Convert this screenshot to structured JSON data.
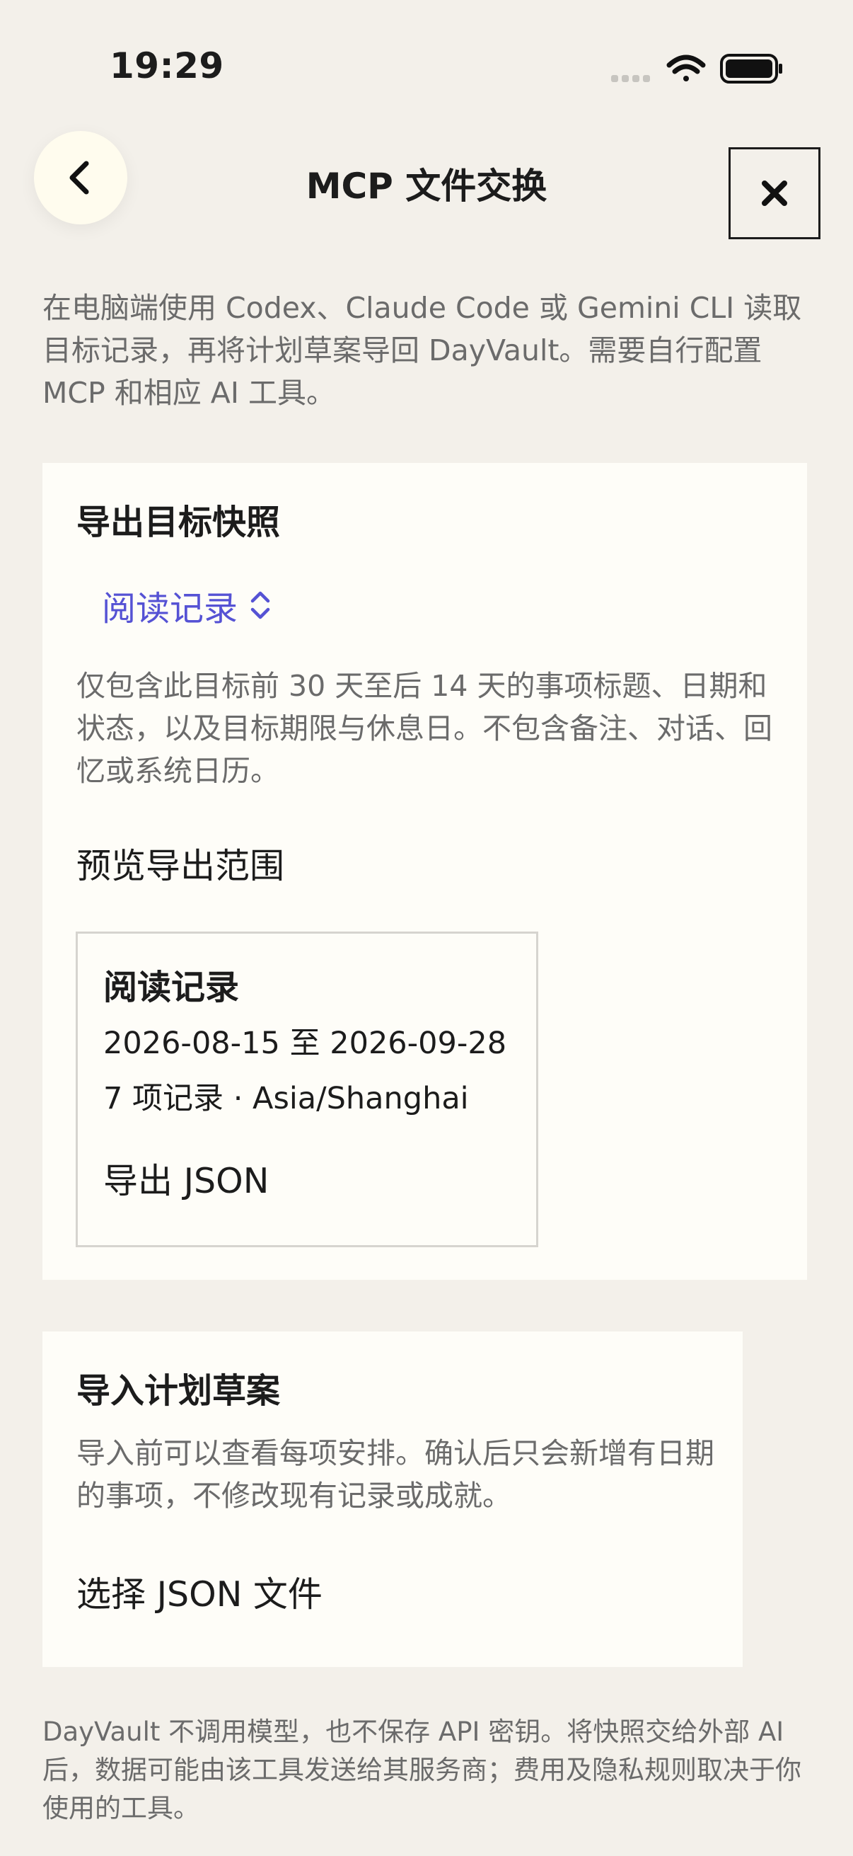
{
  "status_bar": {
    "time": "19:29",
    "icons": [
      "signal-icon",
      "wifi-icon",
      "battery-icon"
    ]
  },
  "nav": {
    "back_icon": "chevron-left-icon",
    "title": "MCP 文件交换",
    "close_icon": "close-icon"
  },
  "intro": "在电脑端使用 Codex、Claude Code 或 Gemini CLI 读取目标记录，再将计划草案导回 DayVault。需要自行配置 MCP 和相应 AI 工具。",
  "export": {
    "title": "导出目标快照",
    "goal_picker": {
      "selected": "阅读记录",
      "icon": "chevron-up-down-icon"
    },
    "description": "仅包含此目标前 30 天至后 14 天的事项标题、日期和状态，以及目标期限与休息日。不包含备注、对话、回忆或系统日历。",
    "preview_label": "预览导出范围",
    "preview": {
      "goal_name": "阅读记录",
      "date_range": "2026-08-15 至 2026-09-28",
      "summary": "7 项记录 · Asia/Shanghai",
      "export_button": "导出 JSON"
    }
  },
  "import": {
    "title": "导入计划草案",
    "description": "导入前可以查看每项安排。确认后只会新增有日期的事项，不修改现有记录或成就。",
    "select_button": "选择 JSON 文件"
  },
  "footer": "DayVault 不调用模型，也不保存 API 密钥。将快照交给外部 AI 后，数据可能由该工具发送给其服务商；费用及隐私规则取决于你使用的工具。",
  "colors": {
    "background": "#f3f0ea",
    "card": "#fefdf8",
    "accent": "#5552d4",
    "text": "#1c1c1c",
    "secondary_text": "#6b6b6b"
  }
}
